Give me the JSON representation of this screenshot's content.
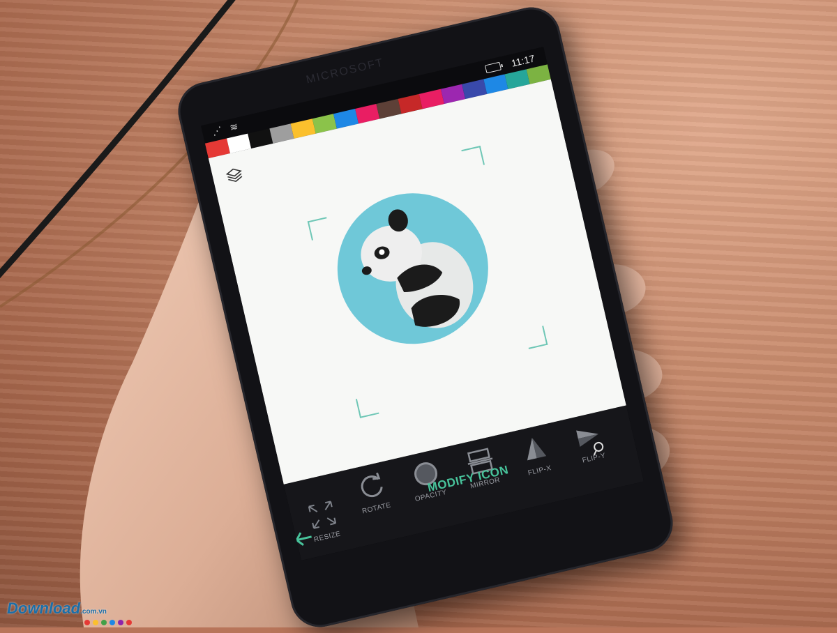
{
  "scene": {
    "description_colors": {
      "table": "#b8755a",
      "phone": "#121216",
      "accent": "#48c39b",
      "panda_bg": "#6fc8d8"
    }
  },
  "phone": {
    "brand": "MICROSOFT",
    "status": {
      "time": "11:17",
      "signal_icons": "⋰ ≋"
    },
    "palette": [
      "#e53935",
      "#ffffff",
      "#111111",
      "#9e9e9e",
      "#fbc02d",
      "#8bc34a",
      "#1e88e5",
      "#e91e63",
      "#5d4037",
      "#c62828",
      "#e91e63",
      "#9c27b0",
      "#3949ab",
      "#1e88e5",
      "#26a69a",
      "#7cb342"
    ],
    "toolbar": {
      "resize": "RESIZE",
      "rotate": "ROTATE",
      "opacity": "OPACITY",
      "mirror": "MIRROR",
      "flip_x": "FLIP-X",
      "flip_y": "FLIP-Y"
    },
    "title": "MODIFY ICON",
    "icons": {
      "layers": "layers-icon",
      "search": "search-icon",
      "back": "back-arrow-icon",
      "windows": "windows-logo-icon"
    }
  },
  "watermark": {
    "text": "Download",
    "suffix": ".com.vn"
  }
}
